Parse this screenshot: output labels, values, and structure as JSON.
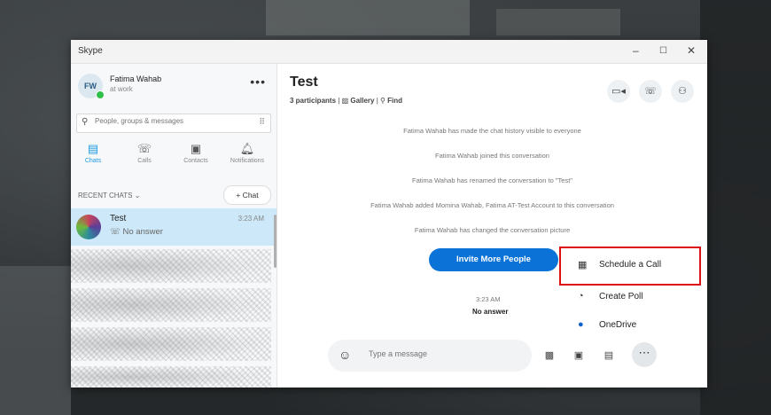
{
  "window": {
    "title": "Skype",
    "min": "–",
    "max": "☐",
    "close": "✕"
  },
  "profile": {
    "initials": "FW",
    "name": "Fatima Wahab",
    "status": "at work"
  },
  "search": {
    "placeholder": "People, groups & messages"
  },
  "nav": [
    {
      "label": "Chats",
      "icon": "chat-icon"
    },
    {
      "label": "Calls",
      "icon": "phone-icon"
    },
    {
      "label": "Contacts",
      "icon": "contacts-icon"
    },
    {
      "label": "Notifications",
      "icon": "bell-icon"
    }
  ],
  "recent_label": "RECENT CHATS ⌄",
  "new_chat": "+ Chat",
  "chats": [
    {
      "name": "Test",
      "subtitle": "☏ No answer",
      "time": "3:23 AM"
    }
  ],
  "conversation": {
    "title": "Test",
    "participants": "3 participants",
    "gallery": "Gallery",
    "find": "Find",
    "system_messages": [
      "Fatima Wahab has made the chat history visible to everyone",
      "Fatima Wahab joined this conversation",
      "Fatima Wahab has renamed the conversation to \"Test\"",
      "Fatima Wahab added Momina Wahab, Fatima AT-Test Account to this conversation",
      "Fatima Wahab has changed the conversation picture"
    ],
    "invite_button": "Invite More People",
    "call_time": "3:23 AM",
    "call_status": "No answer"
  },
  "menu": [
    {
      "label": "Schedule a Call",
      "icon": "calendar-icon"
    },
    {
      "label": "Create Poll",
      "icon": "poll-icon"
    },
    {
      "label": "OneDrive",
      "icon": "onedrive-icon"
    }
  ],
  "compose": {
    "placeholder": "Type a message"
  },
  "colors": {
    "accent": "#0b73d8",
    "highlight": "#dd1111",
    "selected_chat": "#cde8f8"
  }
}
